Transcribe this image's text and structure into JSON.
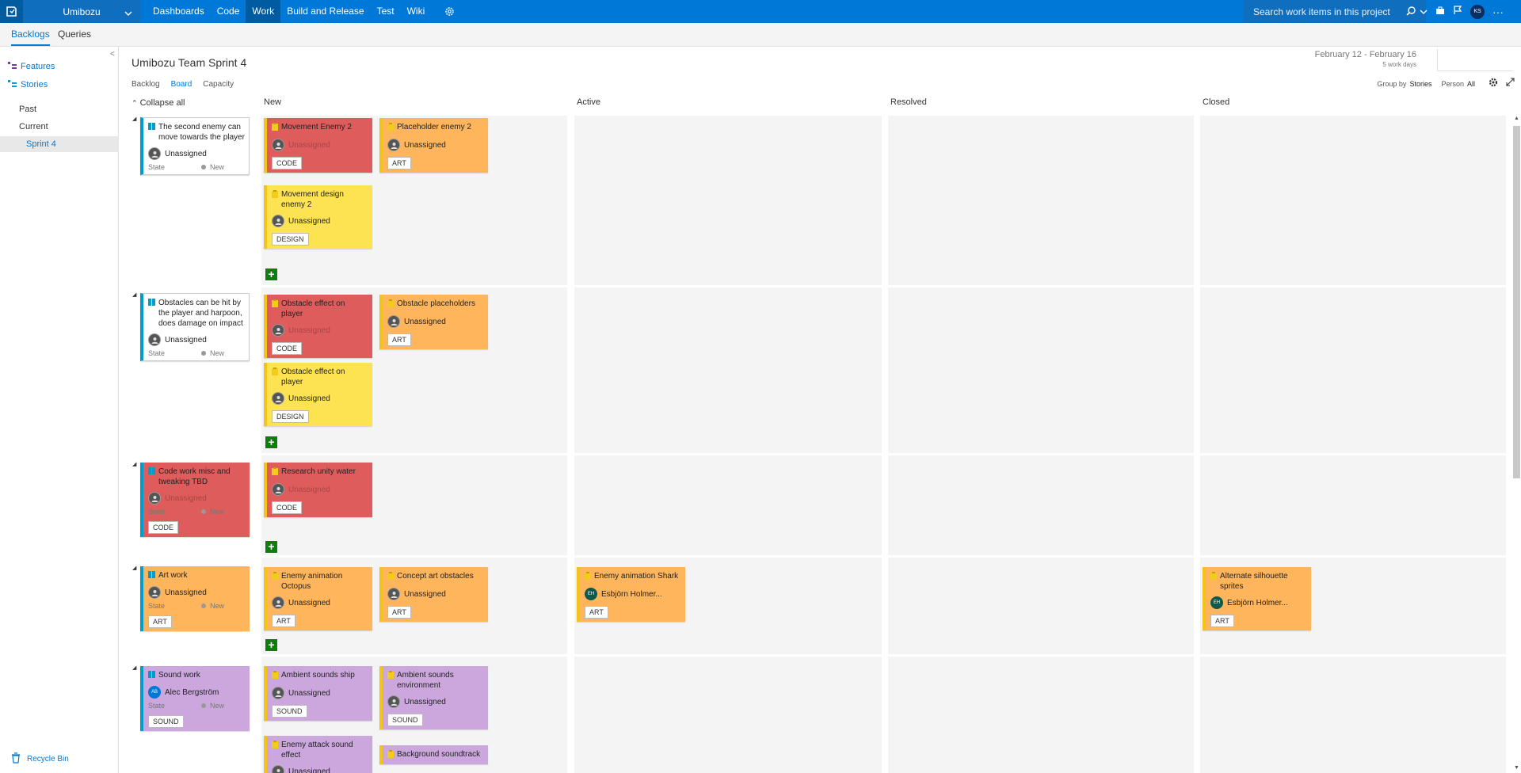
{
  "topbar": {
    "project": "Umibozu",
    "nav": [
      "Dashboards",
      "Code",
      "Work",
      "Build and Release",
      "Test",
      "Wiki"
    ],
    "active_nav": "Work",
    "search_placeholder": "Search work items in this project",
    "user_initials": "KS"
  },
  "subnav": {
    "tabs": [
      "Backlogs",
      "Queries"
    ],
    "active": "Backlogs"
  },
  "sidebar": {
    "features": "Features",
    "stories": "Stories",
    "past": "Past",
    "current": "Current",
    "sprint": "Sprint 4",
    "recycle": "Recycle Bin"
  },
  "header": {
    "title": "Umibozu Team Sprint 4",
    "pivots": [
      "Backlog",
      "Board",
      "Capacity"
    ],
    "active_pivot": "Board",
    "dates": "February 12 - February 16",
    "work_days": "5 work days",
    "group_by_label": "Group by",
    "group_by_value": "Stories",
    "person_label": "Person",
    "person_value": "All",
    "collapse_all": "Collapse all"
  },
  "columns": [
    "New",
    "Active",
    "Resolved",
    "Closed"
  ],
  "common": {
    "unassigned": "Unassigned",
    "state_label": "State",
    "state_value": "New"
  },
  "rows": [
    {
      "story": {
        "title": "The second enemy can move towards the player",
        "assigned": "Unassigned",
        "tag": ""
      },
      "tasks": [
        {
          "title": "Movement Enemy 2",
          "assigned": "Unassigned",
          "tag": "CODE"
        },
        {
          "title": "Placeholder enemy 2",
          "assigned": "Unassigned",
          "tag": "ART"
        },
        {
          "title": "Movement design enemy 2",
          "assigned": "Unassigned",
          "tag": "DESIGN"
        }
      ]
    },
    {
      "story": {
        "title": "Obstacles can be hit by the player and harpoon, does damage on impact",
        "assigned": "Unassigned",
        "tag": ""
      },
      "tasks": [
        {
          "title": "Obstacle effect on player",
          "assigned": "Unassigned",
          "tag": "CODE"
        },
        {
          "title": "Obstacle placeholders",
          "assigned": "Unassigned",
          "tag": "ART"
        },
        {
          "title": "Obstacle effect on player",
          "assigned": "Unassigned",
          "tag": "DESIGN"
        }
      ]
    },
    {
      "story": {
        "title": "Code work misc and tweaking TBD",
        "assigned": "Unassigned",
        "tag": "CODE"
      },
      "tasks": [
        {
          "title": "Research unity water",
          "assigned": "Unassigned",
          "tag": "CODE"
        }
      ]
    },
    {
      "story": {
        "title": "Art work",
        "assigned": "Unassigned",
        "tag": "ART"
      },
      "tasks": [
        {
          "title": "Enemy animation Octopus",
          "assigned": "Unassigned",
          "tag": "ART"
        },
        {
          "title": "Concept art obstacles",
          "assigned": "Unassigned",
          "tag": "ART"
        },
        {
          "title": "Enemy animation Shark",
          "assigned": "Esbjörn Holmer...",
          "initials": "EH",
          "tag": "ART"
        },
        {
          "title": "Alternate silhouette sprites",
          "assigned": "Esbjörn Holmer...",
          "initials": "EH",
          "tag": "ART"
        }
      ]
    },
    {
      "story": {
        "title": "Sound work",
        "assigned": "Alec Bergström",
        "initials": "AB",
        "tag": "SOUND"
      },
      "tasks": [
        {
          "title": "Ambient sounds ship",
          "assigned": "Unassigned",
          "tag": "SOUND"
        },
        {
          "title": "Ambient sounds environment",
          "assigned": "Unassigned",
          "tag": "SOUND"
        },
        {
          "title": "Enemy attack sound effect",
          "assigned": "Unassigned",
          "tag": ""
        },
        {
          "title": "Background soundtrack",
          "assigned": "",
          "tag": ""
        }
      ]
    }
  ],
  "colors": {
    "accent": "#0078d7",
    "code": "#de5c5c",
    "art": "#ffb55c",
    "design": "#fde352",
    "sound": "#cba7dd",
    "story_bar": "#009ccc",
    "add": "#107c10"
  }
}
